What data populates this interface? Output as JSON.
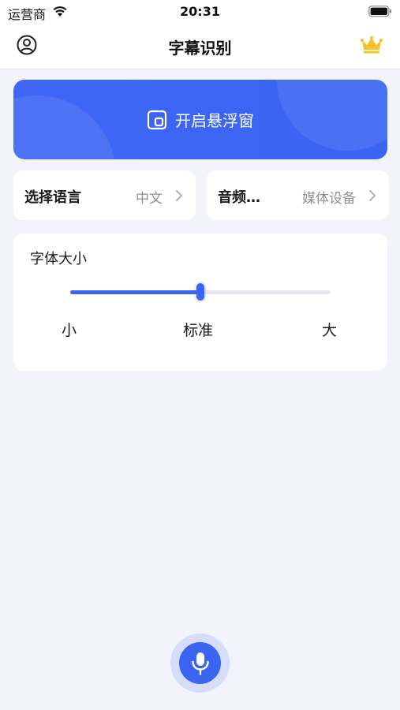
{
  "status_bar": {
    "carrier": "运营商",
    "time": "20:31"
  },
  "nav": {
    "title": "字幕识别",
    "left_icon": "profile-icon",
    "right_icon": "crown-icon",
    "crown_color": "#f5c22a"
  },
  "banner": {
    "label": "开启悬浮窗",
    "icon": "floating-window-icon",
    "color": "#3a64f2"
  },
  "options": [
    {
      "label": "选择语言",
      "value": "中文"
    },
    {
      "label": "音频…",
      "value": "媒体设备"
    }
  ],
  "font_size": {
    "title": "字体大小",
    "ticks": [
      "小",
      "标准",
      "大"
    ],
    "level": 0.5
  },
  "mic": {
    "icon": "microphone-icon"
  }
}
